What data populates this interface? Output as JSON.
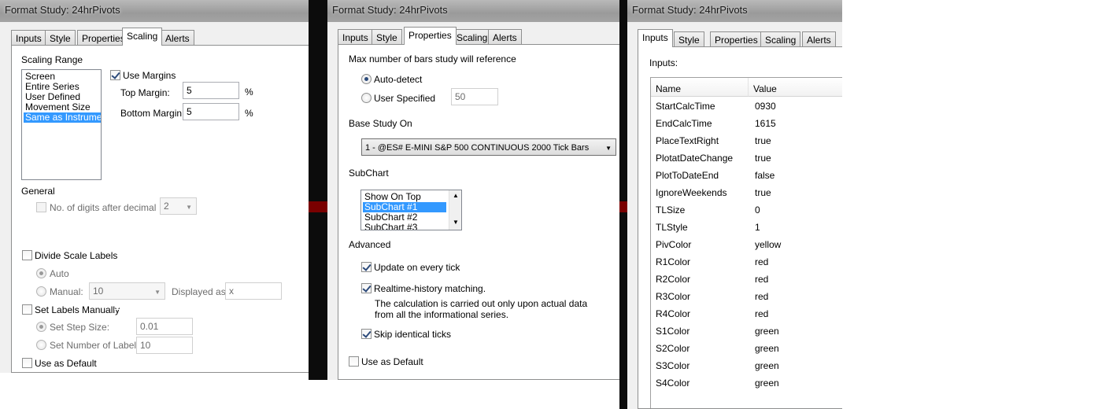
{
  "dialog_title": "Format Study: 24hrPivots",
  "tabs": [
    "Inputs",
    "Style",
    "Properties",
    "Scaling",
    "Alerts"
  ],
  "scaling": {
    "range_group": "Scaling Range",
    "range_options": [
      "Screen",
      "Entire Series",
      "User Defined",
      "Movement Size",
      "Same as Instrument"
    ],
    "use_margins_label": "Use Margins",
    "top_margin_label": "Top Margin:",
    "top_margin_value": "5",
    "bottom_margin_label": "Bottom Margin:",
    "bottom_margin_value": "5",
    "percent_sign": "%",
    "general_group": "General",
    "digits_label": "No. of digits after decimal",
    "digits_value": "2",
    "divide_label": "Divide Scale Labels",
    "auto_label": "Auto",
    "manual_label": "Manual:",
    "manual_value": "10",
    "displayed_as_label": "Displayed as:",
    "displayed_as_value": "x",
    "set_labels_label": "Set Labels Manually",
    "step_size_label": "Set Step Size:",
    "step_size_value": "0.01",
    "num_labels_label": "Set Number of Labels:",
    "num_labels_value": "10",
    "use_default_label": "Use as Default"
  },
  "properties": {
    "max_bars_group": "Max number of bars study will reference",
    "auto_detect_label": "Auto-detect",
    "user_specified_label": "User Specified",
    "user_specified_value": "50",
    "base_study_group": "Base Study On",
    "base_study_value": "1 - @ES# E-MINI S&P 500 CONTINUOUS 2000 Tick Bars",
    "subchart_group": "SubChart",
    "subchart_options": [
      "Show On Top",
      "SubChart #1",
      "SubChart #2",
      "SubChart #3"
    ],
    "advanced_group": "Advanced",
    "update_tick_label": "Update on every tick",
    "realtime_label": "Realtime-history matching.",
    "realtime_note_1": "The calculation is carried out only upon actual data",
    "realtime_note_2": "from all the informational series.",
    "skip_label": "Skip identical ticks",
    "use_default_label": "Use as Default"
  },
  "inputs": {
    "label": "Inputs:",
    "col_name": "Name",
    "col_value": "Value",
    "rows": [
      {
        "name": "StartCalcTime",
        "value": "0930"
      },
      {
        "name": "EndCalcTime",
        "value": "1615"
      },
      {
        "name": "PlaceTextRight",
        "value": "true"
      },
      {
        "name": "PlotatDateChange",
        "value": "true"
      },
      {
        "name": "PlotToDateEnd",
        "value": "false"
      },
      {
        "name": "IgnoreWeekends",
        "value": "true"
      },
      {
        "name": "TLSize",
        "value": "0"
      },
      {
        "name": "TLStyle",
        "value": "1"
      },
      {
        "name": "PivColor",
        "value": "yellow"
      },
      {
        "name": "R1Color",
        "value": "red"
      },
      {
        "name": "R2Color",
        "value": "red"
      },
      {
        "name": "R3Color",
        "value": "red"
      },
      {
        "name": "R4Color",
        "value": "red"
      },
      {
        "name": "S1Color",
        "value": "green"
      },
      {
        "name": "S2Color",
        "value": "green"
      },
      {
        "name": "S3Color",
        "value": "green"
      },
      {
        "name": "S4Color",
        "value": "green"
      }
    ]
  },
  "colors": {
    "selection": "#3399ff",
    "panel_bg": "#f0f0f0",
    "backdrop": "#0c0c0c",
    "backdrop_red": "#7a0000"
  }
}
